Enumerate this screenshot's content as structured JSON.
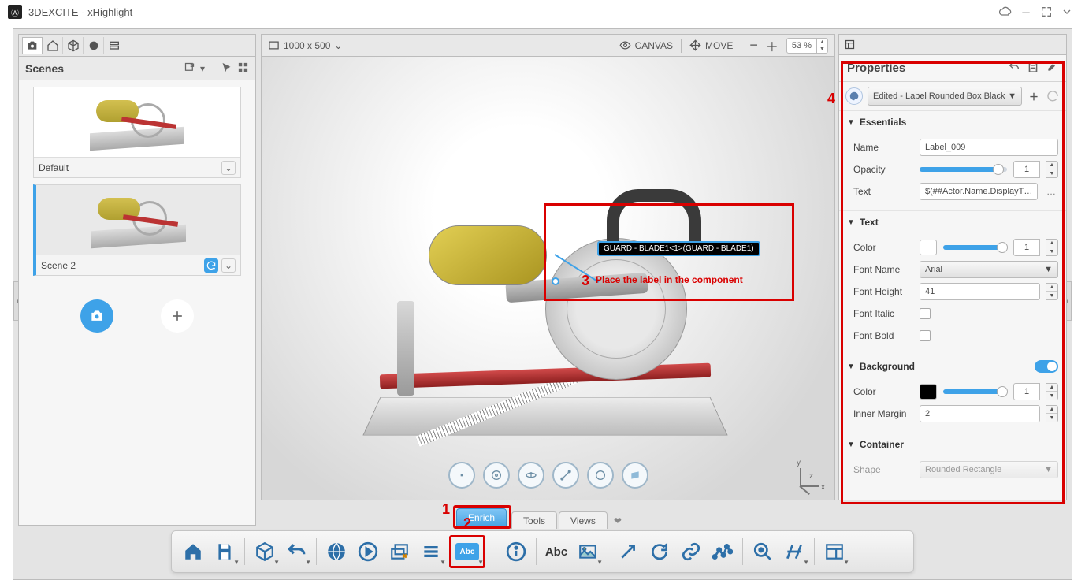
{
  "app": {
    "title": "3DEXCITE - xHighlight"
  },
  "scenes_panel": {
    "title": "Scenes",
    "items": [
      {
        "name": "Default",
        "active": false,
        "syncing": false
      },
      {
        "name": "Scene 2",
        "active": true,
        "syncing": true
      }
    ]
  },
  "canvas": {
    "resolution": "1000 x 500",
    "mode_canvas_label": "CANVAS",
    "mode_move_label": "MOVE",
    "zoom": "53 %"
  },
  "viewport": {
    "label_text": "GUARD - BLADE1<1>(GUARD - BLADE1)",
    "annotation_3_num": "3",
    "annotation_3_text": "Place the label in the component"
  },
  "tabs": {
    "enrich": "Enrich",
    "tools": "Tools",
    "views": "Views"
  },
  "annotation_numbers": {
    "one": "1",
    "two": "2",
    "four": "4"
  },
  "toolbar": {
    "abc": "Abc",
    "abc_small": "Abc"
  },
  "properties": {
    "title": "Properties",
    "style_name": "Edited - Label Rounded Box Black",
    "sections": {
      "essentials": {
        "title": "Essentials",
        "name_label": "Name",
        "name_value": "Label_009",
        "opacity_label": "Opacity",
        "opacity_value": "1",
        "text_label": "Text",
        "text_value": "$(##Actor.Name.DisplayT…"
      },
      "text": {
        "title": "Text",
        "color_label": "Color",
        "color_value": "1",
        "fontname_label": "Font Name",
        "fontname_value": "Arial",
        "fontheight_label": "Font Height",
        "fontheight_value": "41",
        "italic_label": "Font Italic",
        "bold_label": "Font Bold"
      },
      "background": {
        "title": "Background",
        "color_label": "Color",
        "color_value": "1",
        "margin_label": "Inner Margin",
        "margin_value": "2"
      },
      "container": {
        "title": "Container",
        "shape_label": "Shape",
        "shape_value": "Rounded Rectangle"
      }
    }
  }
}
